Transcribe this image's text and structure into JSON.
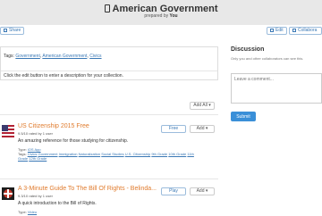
{
  "header": {
    "title": "American Government",
    "byline_prefix": "prepared by",
    "byline_author": "You"
  },
  "toolbar": {
    "share_label": "Share",
    "edit_label": "Edit",
    "collaborate_label": "Collabora"
  },
  "collection": {
    "tags_label": "Tags:",
    "tags": [
      "Government",
      "American Government",
      "Civics"
    ],
    "description": "Click the edit button to enter a description for your collection."
  },
  "list": {
    "sort_label": "Add All"
  },
  "items": [
    {
      "name": "US Citizenship 2015 Free",
      "rating": "9.5/10 rated by 1 user",
      "description": "An amazing reference for those studying for citizenship.",
      "type_label": "Type:",
      "type": "iOS App",
      "tags_label": "Tags:",
      "tags": [
        "Civics",
        "Government",
        "Immigration",
        "Naturalization",
        "Social Studies",
        "U.S. Citizenship",
        "9th Grade",
        "10th Grade",
        "11th Grade",
        "12th Grade"
      ],
      "action_label": "Free",
      "add_label": "Add"
    },
    {
      "name": "A 3-Minute Guide To The Bill Of Rights - Belinda...",
      "rating": "9.3/10 rated by 1 user",
      "description": "A quick introduction to the Bill of Rights.",
      "type_label": "Type:",
      "type": "Video",
      "action_label": "Play",
      "add_label": "Add"
    }
  ],
  "discussion": {
    "title": "Discussion",
    "subtitle": "Only you and other collaborators can see this.",
    "placeholder": "Leave a comment...",
    "submit_label": "Submit"
  }
}
